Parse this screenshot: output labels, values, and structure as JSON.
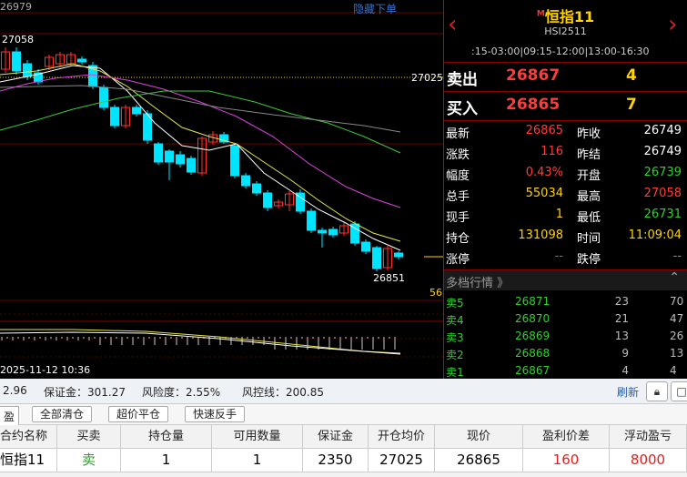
{
  "chart": {
    "top_left_label": "26979",
    "hide_order_link": "隐藏下单",
    "high_label": "27058",
    "order_line_label": "27025",
    "low_label": "26851",
    "right_cut_label": "56",
    "time_label": "2025-11-12 10:36",
    "colors": {
      "up": "#ff3030",
      "down": "#00e5ff",
      "ma5": "#ffffff",
      "ma10": "#e6e64c",
      "ma20": "#e040e0",
      "ma60": "#3cc83c",
      "ma_long": "#888888",
      "order_line": "#ffd200"
    }
  },
  "quote": {
    "name": "恒指11",
    "badge": "M",
    "code": "HSI2511",
    "session_times": ":15-03:00|09:15-12:00|13:00-16:30",
    "prev_icon": "chevron-left-icon",
    "next_icon": "chevron-right-icon",
    "sell": {
      "label": "卖出",
      "price": "26867",
      "volume": "4"
    },
    "buy": {
      "label": "买入",
      "price": "26865",
      "volume": "7"
    },
    "stats": [
      {
        "l1": "最新",
        "v1": "26865",
        "c1": "red",
        "l2": "昨收",
        "v2": "26749",
        "c2": "white"
      },
      {
        "l1": "涨跌",
        "v1": "116",
        "c1": "red",
        "l2": "昨结",
        "v2": "26749",
        "c2": "white"
      },
      {
        "l1": "幅度",
        "v1": "0.43%",
        "c1": "red",
        "l2": "开盘",
        "v2": "26739",
        "c2": "green"
      },
      {
        "l1": "总手",
        "v1": "55034",
        "c1": "yellow",
        "l2": "最高",
        "v2": "27058",
        "c2": "red"
      },
      {
        "l1": "现手",
        "v1": "1",
        "c1": "yellow",
        "l2": "最低",
        "v2": "26731",
        "c2": "green"
      },
      {
        "l1": "持仓",
        "v1": "131098",
        "c1": "yellow",
        "l2": "时间",
        "v2": "11:09:04",
        "c2": "yellow"
      },
      {
        "l1": "涨停",
        "v1": "--",
        "c1": "red",
        "l2": "跌停",
        "v2": "--",
        "c2": "green"
      }
    ],
    "depth_title": "多档行情",
    "depth": [
      {
        "label": "卖5",
        "price": "26871",
        "vol": "23",
        "extra": "70"
      },
      {
        "label": "卖4",
        "price": "26870",
        "vol": "21",
        "extra": "47"
      },
      {
        "label": "卖3",
        "price": "26869",
        "vol": "13",
        "extra": "26"
      },
      {
        "label": "卖2",
        "price": "26868",
        "vol": "9",
        "extra": "13"
      },
      {
        "label": "卖1",
        "price": "26867",
        "vol": "4",
        "extra": "4"
      }
    ]
  },
  "account": {
    "first_value": "2.96",
    "margin": "保证金：301.27",
    "risk": "风险度：2.55%",
    "risk_line": "风控线：200.85",
    "refresh": "刷新"
  },
  "actions": {
    "tab_cut": "盈",
    "close_all": "全部清仓",
    "overprice_close": "超价平仓",
    "quick_reverse": "快速反手"
  },
  "table": {
    "headers": [
      "合约名称",
      "买卖",
      "持仓量",
      "可用数量",
      "保证金",
      "开仓均价",
      "现价",
      "盈利价差",
      "浮动盈亏"
    ],
    "rows": [
      [
        "恒指11",
        "卖",
        "1",
        "1",
        "2350",
        "27025",
        "26865",
        "160",
        "8000"
      ]
    ]
  }
}
